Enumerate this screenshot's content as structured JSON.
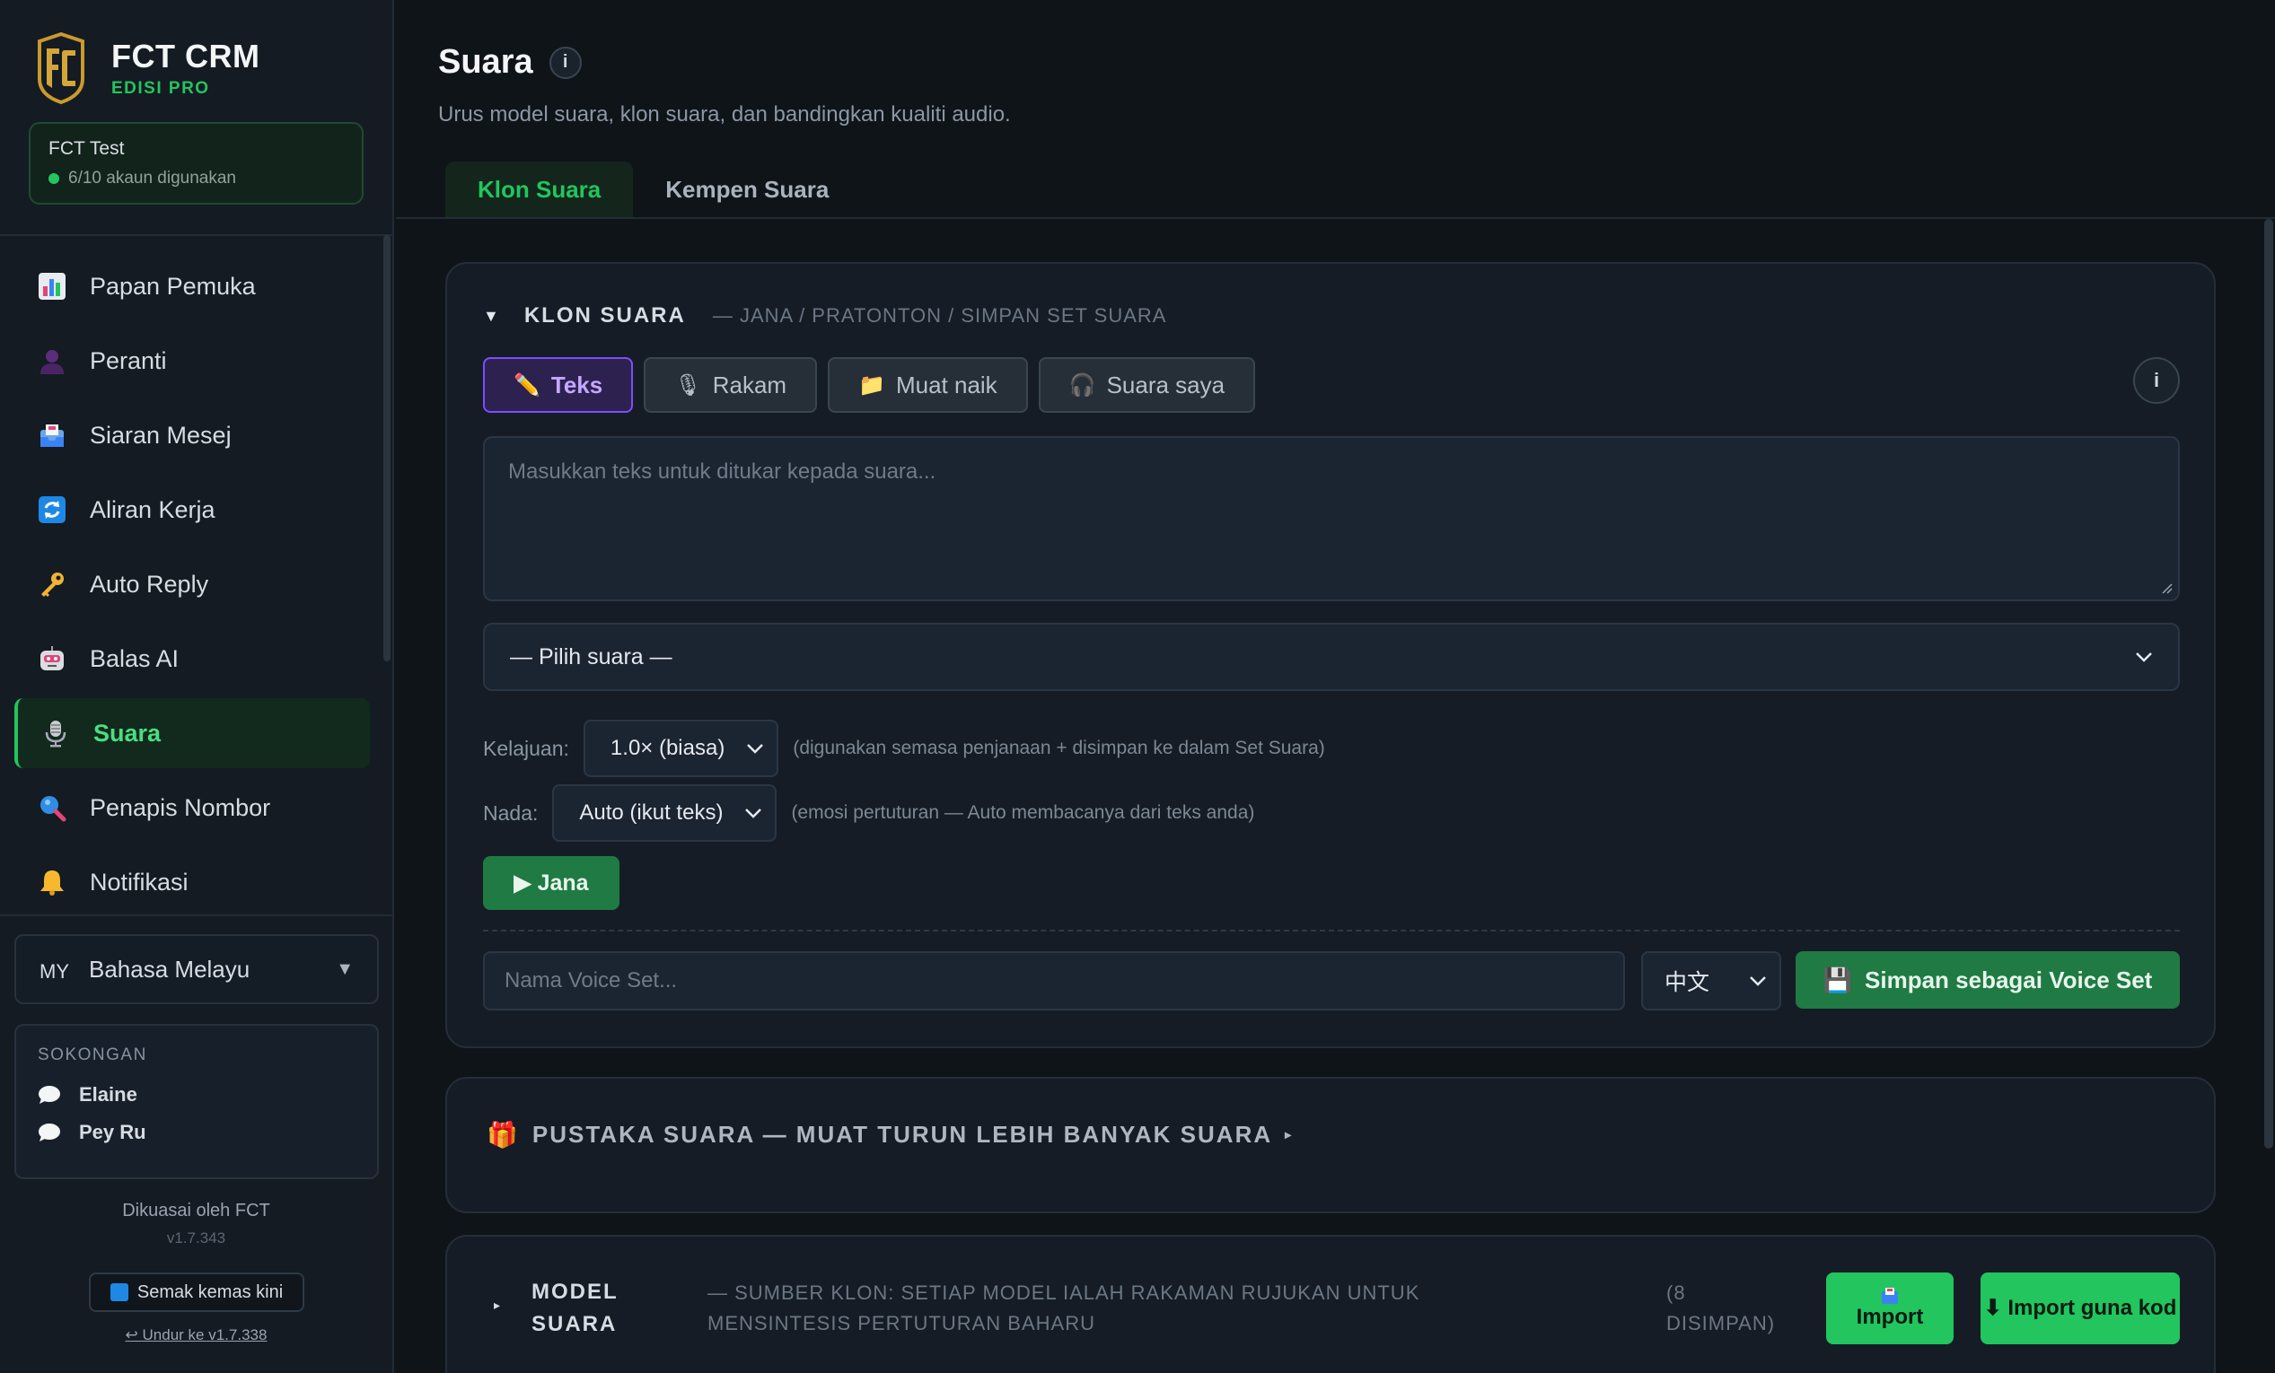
{
  "brand": {
    "title": "FCT CRM",
    "edition": "EDISI PRO"
  },
  "account": {
    "name": "FCT Test",
    "usage": "6/10 akaun digunakan"
  },
  "sidebar": {
    "items": [
      {
        "label": "Papan Pemuka",
        "icon": "bar-chart-icon"
      },
      {
        "label": "Peranti",
        "icon": "person-icon"
      },
      {
        "label": "Siaran Mesej",
        "icon": "inbox-icon"
      },
      {
        "label": "Aliran Kerja",
        "icon": "refresh-icon"
      },
      {
        "label": "Auto Reply",
        "icon": "key-icon"
      },
      {
        "label": "Balas AI",
        "icon": "robot-icon"
      },
      {
        "label": "Suara",
        "icon": "microphone-icon",
        "active": true
      },
      {
        "label": "Penapis Nombor",
        "icon": "magnifier-icon"
      },
      {
        "label": "Notifikasi",
        "icon": "bell-icon"
      }
    ],
    "language": {
      "code": "MY",
      "label": "Bahasa Melayu"
    },
    "support": {
      "title": "SOKONGAN",
      "contacts": [
        "Elaine",
        "Pey Ru"
      ]
    },
    "powered_by": "Dikuasai oleh FCT",
    "version": "v1.7.343",
    "update_label": "Semak kemas kini",
    "rollback_label": "↩ Undur ke v1.7.338"
  },
  "page": {
    "title": "Suara",
    "subtitle": "Urus model suara, klon suara, dan bandingkan kualiti audio.",
    "tabs": [
      "Klon Suara",
      "Kempen Suara"
    ]
  },
  "clone": {
    "title": "KLON SUARA",
    "desc": "— JANA / PRATONTON / SIMPAN SET SUARA",
    "modes": [
      "Teks",
      "Rakam",
      "Muat naik",
      "Suara saya"
    ],
    "textarea_placeholder": "Masukkan teks untuk ditukar kepada suara...",
    "voice_select": "— Pilih suara —",
    "speed_label": "Kelajuan:",
    "speed_value": "1.0× (biasa)",
    "speed_hint": "(digunakan semasa penjanaan + disimpan ke dalam Set Suara)",
    "tone_label": "Nada:",
    "tone_value": "Auto (ikut teks)",
    "tone_hint": "(emosi pertuturan — Auto membacanya dari teks anda)",
    "generate_label": "▶ Jana",
    "name_placeholder": "Nama Voice Set...",
    "lang_value": "中文",
    "save_label": "Simpan sebagai Voice Set"
  },
  "library": {
    "title": "PUSTAKA SUARA — MUAT TURUN LEBIH BANYAK SUARA"
  },
  "models": {
    "title_line1": "MODEL",
    "title_line2": "SUARA",
    "desc": "— SUMBER KLON: SETIAP MODEL IALAH RAKAMAN RUJUKAN UNTUK MENSINTESIS PERTUTURAN BAHARU",
    "count_line1": "(8",
    "count_line2": "DISIMPAN)",
    "import_label": "Import",
    "import_code_label": "⬇ Import guna kod"
  },
  "colors": {
    "accent": "#22c55e",
    "purple": "#7c4dff",
    "bg": "#0f1419"
  }
}
